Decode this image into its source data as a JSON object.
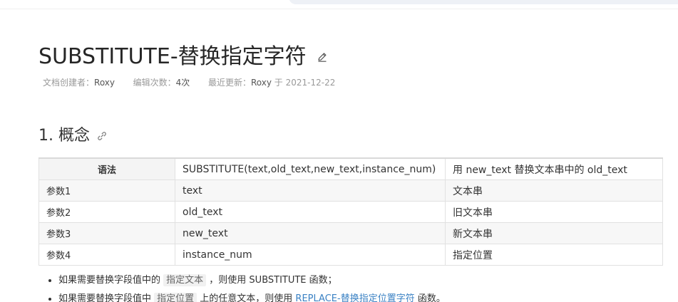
{
  "doc": {
    "title": "SUBSTITUTE-替换指定字符",
    "meta": {
      "creator_label": "文档创建者：",
      "creator": "Roxy",
      "edits_label": "编辑次数：",
      "edits": "4次",
      "updated_label": "最近更新：",
      "updated_by": "Roxy",
      "updated_sep": " 于 ",
      "updated_date": "2021-12-22"
    }
  },
  "section": {
    "heading": "1. 概念"
  },
  "table": {
    "header": {
      "c1": "语法",
      "c2": "SUBSTITUTE(text,old_text,new_text,instance_num)",
      "c3": "用 new_text 替换文本串中的 old_text"
    },
    "rows": [
      {
        "c1": "参数1",
        "c2": "text",
        "c3": "文本串"
      },
      {
        "c1": "参数2",
        "c2": "old_text",
        "c3": "旧文本串"
      },
      {
        "c1": "参数3",
        "c2": "new_text",
        "c3": "新文本串"
      },
      {
        "c1": "参数4",
        "c2": "instance_num",
        "c3": "指定位置"
      }
    ]
  },
  "notes": [
    {
      "pre": "如果需要替换字段值中的 ",
      "code": "指定文本",
      "post": " ，则使用 SUBSTITUTE 函数；"
    },
    {
      "pre": "如果需要替换字段值中 ",
      "code": "指定位置",
      "mid": " 上的任意文本，则使用 ",
      "link": "REPLACE-替换指定位置字符",
      "post": " 函数。"
    }
  ],
  "icons": {
    "edit": "pencil-edit-icon",
    "anchor": "link-anchor-icon"
  }
}
